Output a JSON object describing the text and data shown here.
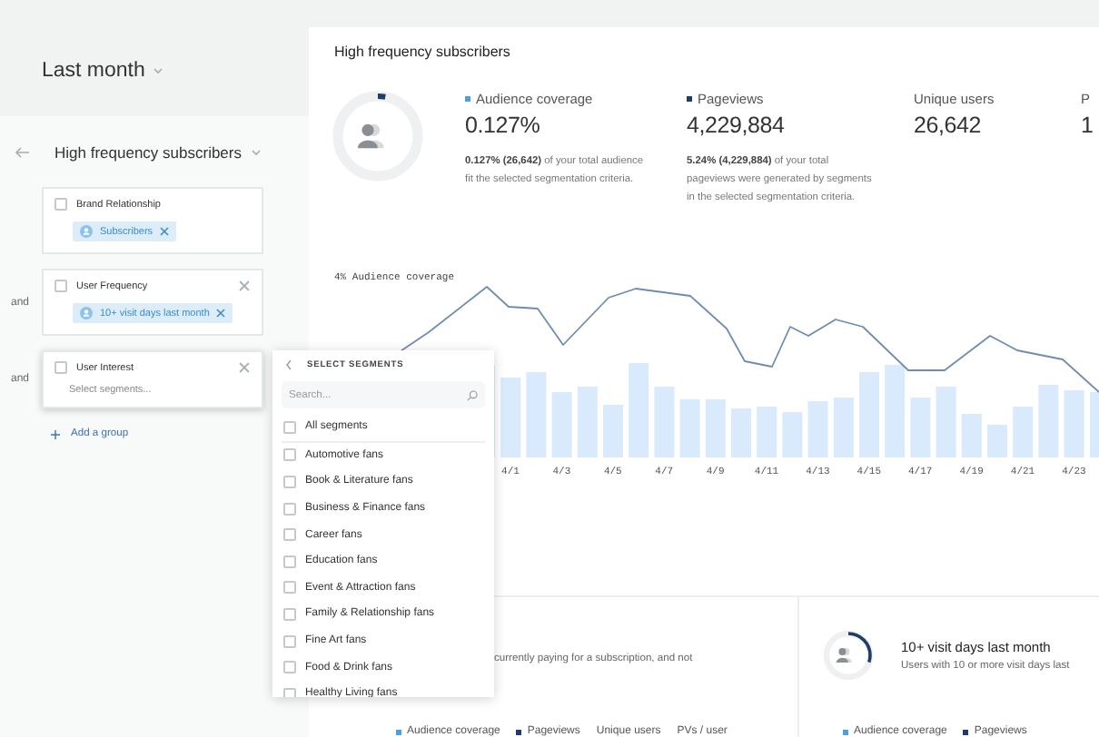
{
  "sidebar": {
    "period": "Last month",
    "segment_title": "High frequency subscribers",
    "groups": [
      {
        "title": "Brand Relationship",
        "removable": false,
        "focused": false,
        "tags": [
          {
            "label": "Subscribers"
          }
        ]
      },
      {
        "connector": "and",
        "title": "User Frequency",
        "removable": true,
        "focused": false,
        "tags": [
          {
            "label": "10+ visit days last month"
          }
        ]
      },
      {
        "connector": "and",
        "title": "User Interest",
        "removable": true,
        "focused": true,
        "placeholder": "Select segments..."
      }
    ],
    "add_group": "Add a group"
  },
  "popover": {
    "title": "SELECT SEGMENTS",
    "search_placeholder": "Search...",
    "items": [
      {
        "label": "All segments",
        "checked": false
      },
      {
        "label": "Automotive fans",
        "checked": false
      },
      {
        "label": "Book & Literature fans",
        "checked": false
      },
      {
        "label": "Business & Finance fans",
        "checked": false
      },
      {
        "label": "Career fans",
        "checked": false
      },
      {
        "label": "Education fans",
        "checked": false
      },
      {
        "label": "Event & Attraction fans",
        "checked": false
      },
      {
        "label": "Family & Relationship fans",
        "checked": false
      },
      {
        "label": "Fine Art fans",
        "checked": false
      },
      {
        "label": "Food & Drink fans",
        "checked": false
      },
      {
        "label": "Healthy Living fans",
        "checked": false
      }
    ]
  },
  "main": {
    "title": "High frequency subscribers",
    "donut": {
      "level": 0.03
    },
    "metrics": [
      {
        "label": "Audience coverage",
        "color": "#4aa3df",
        "value": "0.127%",
        "description": "**0.127% (26,642)** of your total audience fit the selected segmentation criteria."
      },
      {
        "label": "Pageviews",
        "color": "#1f3d66",
        "value": "4,229,884",
        "description": "**5.24% (4,229,884)** of your total pageviews were generated by segments in the selected segmentation criteria."
      },
      {
        "label": "Unique users",
        "value": "26,642"
      },
      {
        "label": "P",
        "value": "1"
      }
    ],
    "chart": {
      "title": "4% Audience coverage",
      "x_labels": [
        "4/1",
        "4/3",
        "4/5",
        "4/7",
        "4/9",
        "4/11",
        "4/13",
        "4/15",
        "4/17",
        "4/19",
        "4/21",
        "4/23"
      ]
    },
    "cards": [
      {
        "description": "currently paying for a subscription, and not",
        "legend": [
          {
            "label": "Audience coverage",
            "color": "#4aa3df"
          },
          {
            "label": "Pageviews",
            "color": "#1f3d66"
          },
          {
            "label": "Unique users"
          },
          {
            "label": "PVs / user"
          }
        ]
      },
      {
        "title": "10+ visit days last month",
        "description": "Users with 10 or more visit days last",
        "donut": {
          "level": 0.3
        },
        "legend": [
          {
            "label": "Audience coverage",
            "color": "#4aa3df"
          },
          {
            "label": "Pageviews",
            "color": "#1f3d66"
          }
        ]
      }
    ]
  }
}
